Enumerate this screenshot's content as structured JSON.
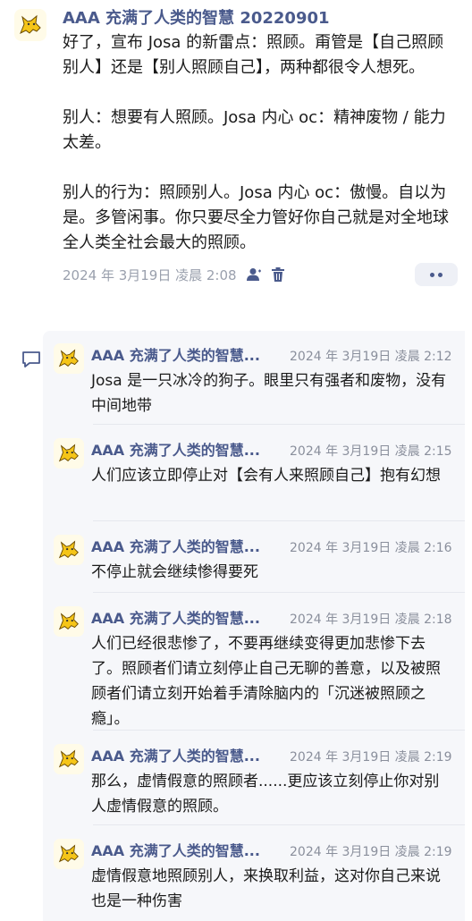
{
  "post": {
    "author": "AAA 充满了人类的智慧 20220901",
    "paragraphs": [
      "好了，宣布 Josa 的新雷点：照顾。甭管是【自己照顾别人】还是【别人照顾自己】，两种都很令人想死。",
      "别人：想要有人照顾。Josa 内心 oc：精神废物 / 能力太差。",
      "别人的行为：照顾别人。Josa 内心 oc：傲慢。自以为是。多管闲事。你只要尽全力管好你自己就是对全地球全人类全社会最大的照顾。"
    ],
    "timestamp": "2024 年 3月19日 凌晨 2:08"
  },
  "replies": [
    {
      "author": "AAA 充满了人类的智慧...",
      "time": "2024 年 3月19日 凌晨 2:12",
      "text": "Josa 是一只冰冷的狗子。眼里只有强者和废物，没有中间地带"
    },
    {
      "author": "AAA 充满了人类的智慧...",
      "time": "2024 年 3月19日 凌晨 2:15",
      "text": "人们应该立即停止对【会有人来照顾自己】抱有幻想"
    },
    {
      "author": "AAA 充满了人类的智慧...",
      "time": "2024 年 3月19日 凌晨 2:16",
      "text": "不停止就会继续惨得要死"
    },
    {
      "author": "AAA 充满了人类的智慧...",
      "time": "2024 年 3月19日 凌晨 2:18",
      "text": "人们已经很悲惨了，不要再继续变得更加悲惨下去了。照顾者们请立刻停止自己无聊的善意，以及被照顾者们请立刻开始着手清除脑内的「沉迷被照顾之瘾」。"
    },
    {
      "author": "AAA 充满了人类的智慧...",
      "time": "2024 年 3月19日 凌晨 2:19",
      "text": "那么，虚情假意的照顾者......更应该立刻停止你对别人虚情假意的照顾。"
    },
    {
      "author": "AAA 充满了人类的智慧...",
      "time": "2024 年 3月19日 凌晨 2:19",
      "text": "虚情假意地照顾别人，来换取利益，这对你自己来说也是一种伤害"
    }
  ],
  "icons": {
    "avatar": "yellow-cat-icon",
    "author_icon": "person-icon",
    "delete": "trash-icon",
    "more": "more-dots-icon",
    "comment": "comment-icon"
  },
  "colors": {
    "link": "#4a5a8c",
    "meta": "#9aa0ad",
    "thread_bg": "#f6f7fa"
  }
}
